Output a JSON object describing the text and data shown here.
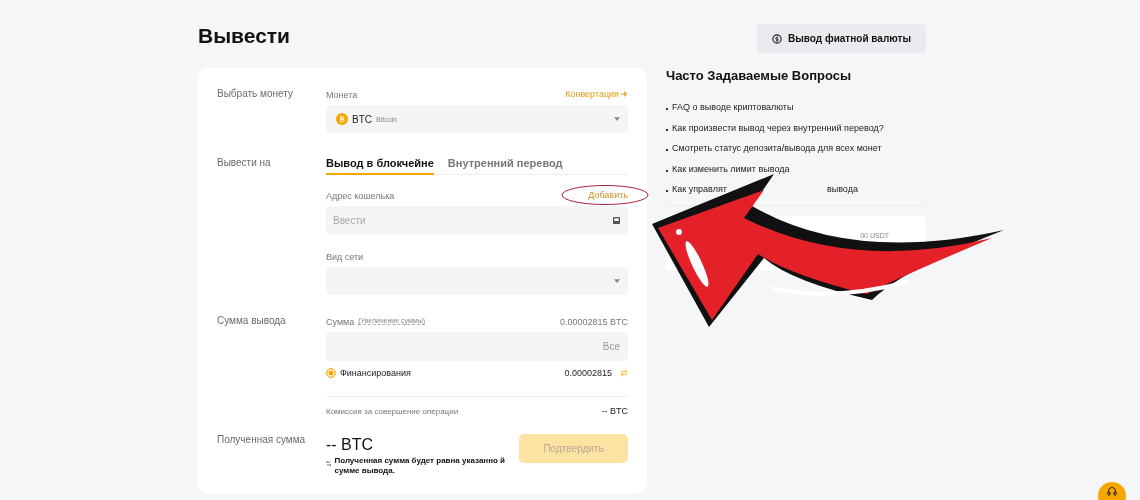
{
  "page": {
    "title": "Вывести",
    "fiat_button": "Вывод фиатной валюты"
  },
  "form": {
    "coin": {
      "section": "Выбрать монету",
      "label": "Монета",
      "link": "Конвертация",
      "symbol": "BTC",
      "name": "Bitcoin"
    },
    "destination": {
      "section": "Вывести на",
      "tabs": [
        {
          "label": "Вывод в блокчейне",
          "selected": true
        },
        {
          "label": "Внутренний перевод",
          "selected": false
        }
      ],
      "address_label": "Адрес кошелька",
      "add_link": "Добавить",
      "address_placeholder": "Ввести",
      "network_label": "Вид сети"
    },
    "amount": {
      "section": "Сумма вывода",
      "label": "Сумма",
      "hint": "(Увеличение суммы)",
      "available": "0.00002815 BTC",
      "all_button": "Все",
      "wallets": [
        {
          "label": "Финансирования",
          "selected": true,
          "balance": "0.00002815"
        }
      ],
      "fee_label": "Комиссия за совершение операции",
      "fee_value": "-- BTC"
    },
    "received": {
      "section": "Полученная сумма",
      "value": "-- BTC",
      "note": "Полученная сумма будет равна указанно й сумме вывода.",
      "confirm": "Подтвердить",
      "confirm_disabled": true
    }
  },
  "faq": {
    "title": "Часто Задаваемые Вопросы",
    "items": [
      {
        "parts": [
          "FAQ о выводе криптовалюты"
        ]
      },
      {
        "parts": [
          "Как произвести вывод через внутренний перевод?"
        ]
      },
      {
        "parts": [
          "Смотреть статус депозита/вывода для всех монет"
        ]
      },
      {
        "parts": [
          "Как изменить лимит вывода"
        ]
      },
      {
        "parts": [
          "Как управлят",
          "вывода"
        ]
      }
    ],
    "limit_card": "00 USDT"
  }
}
